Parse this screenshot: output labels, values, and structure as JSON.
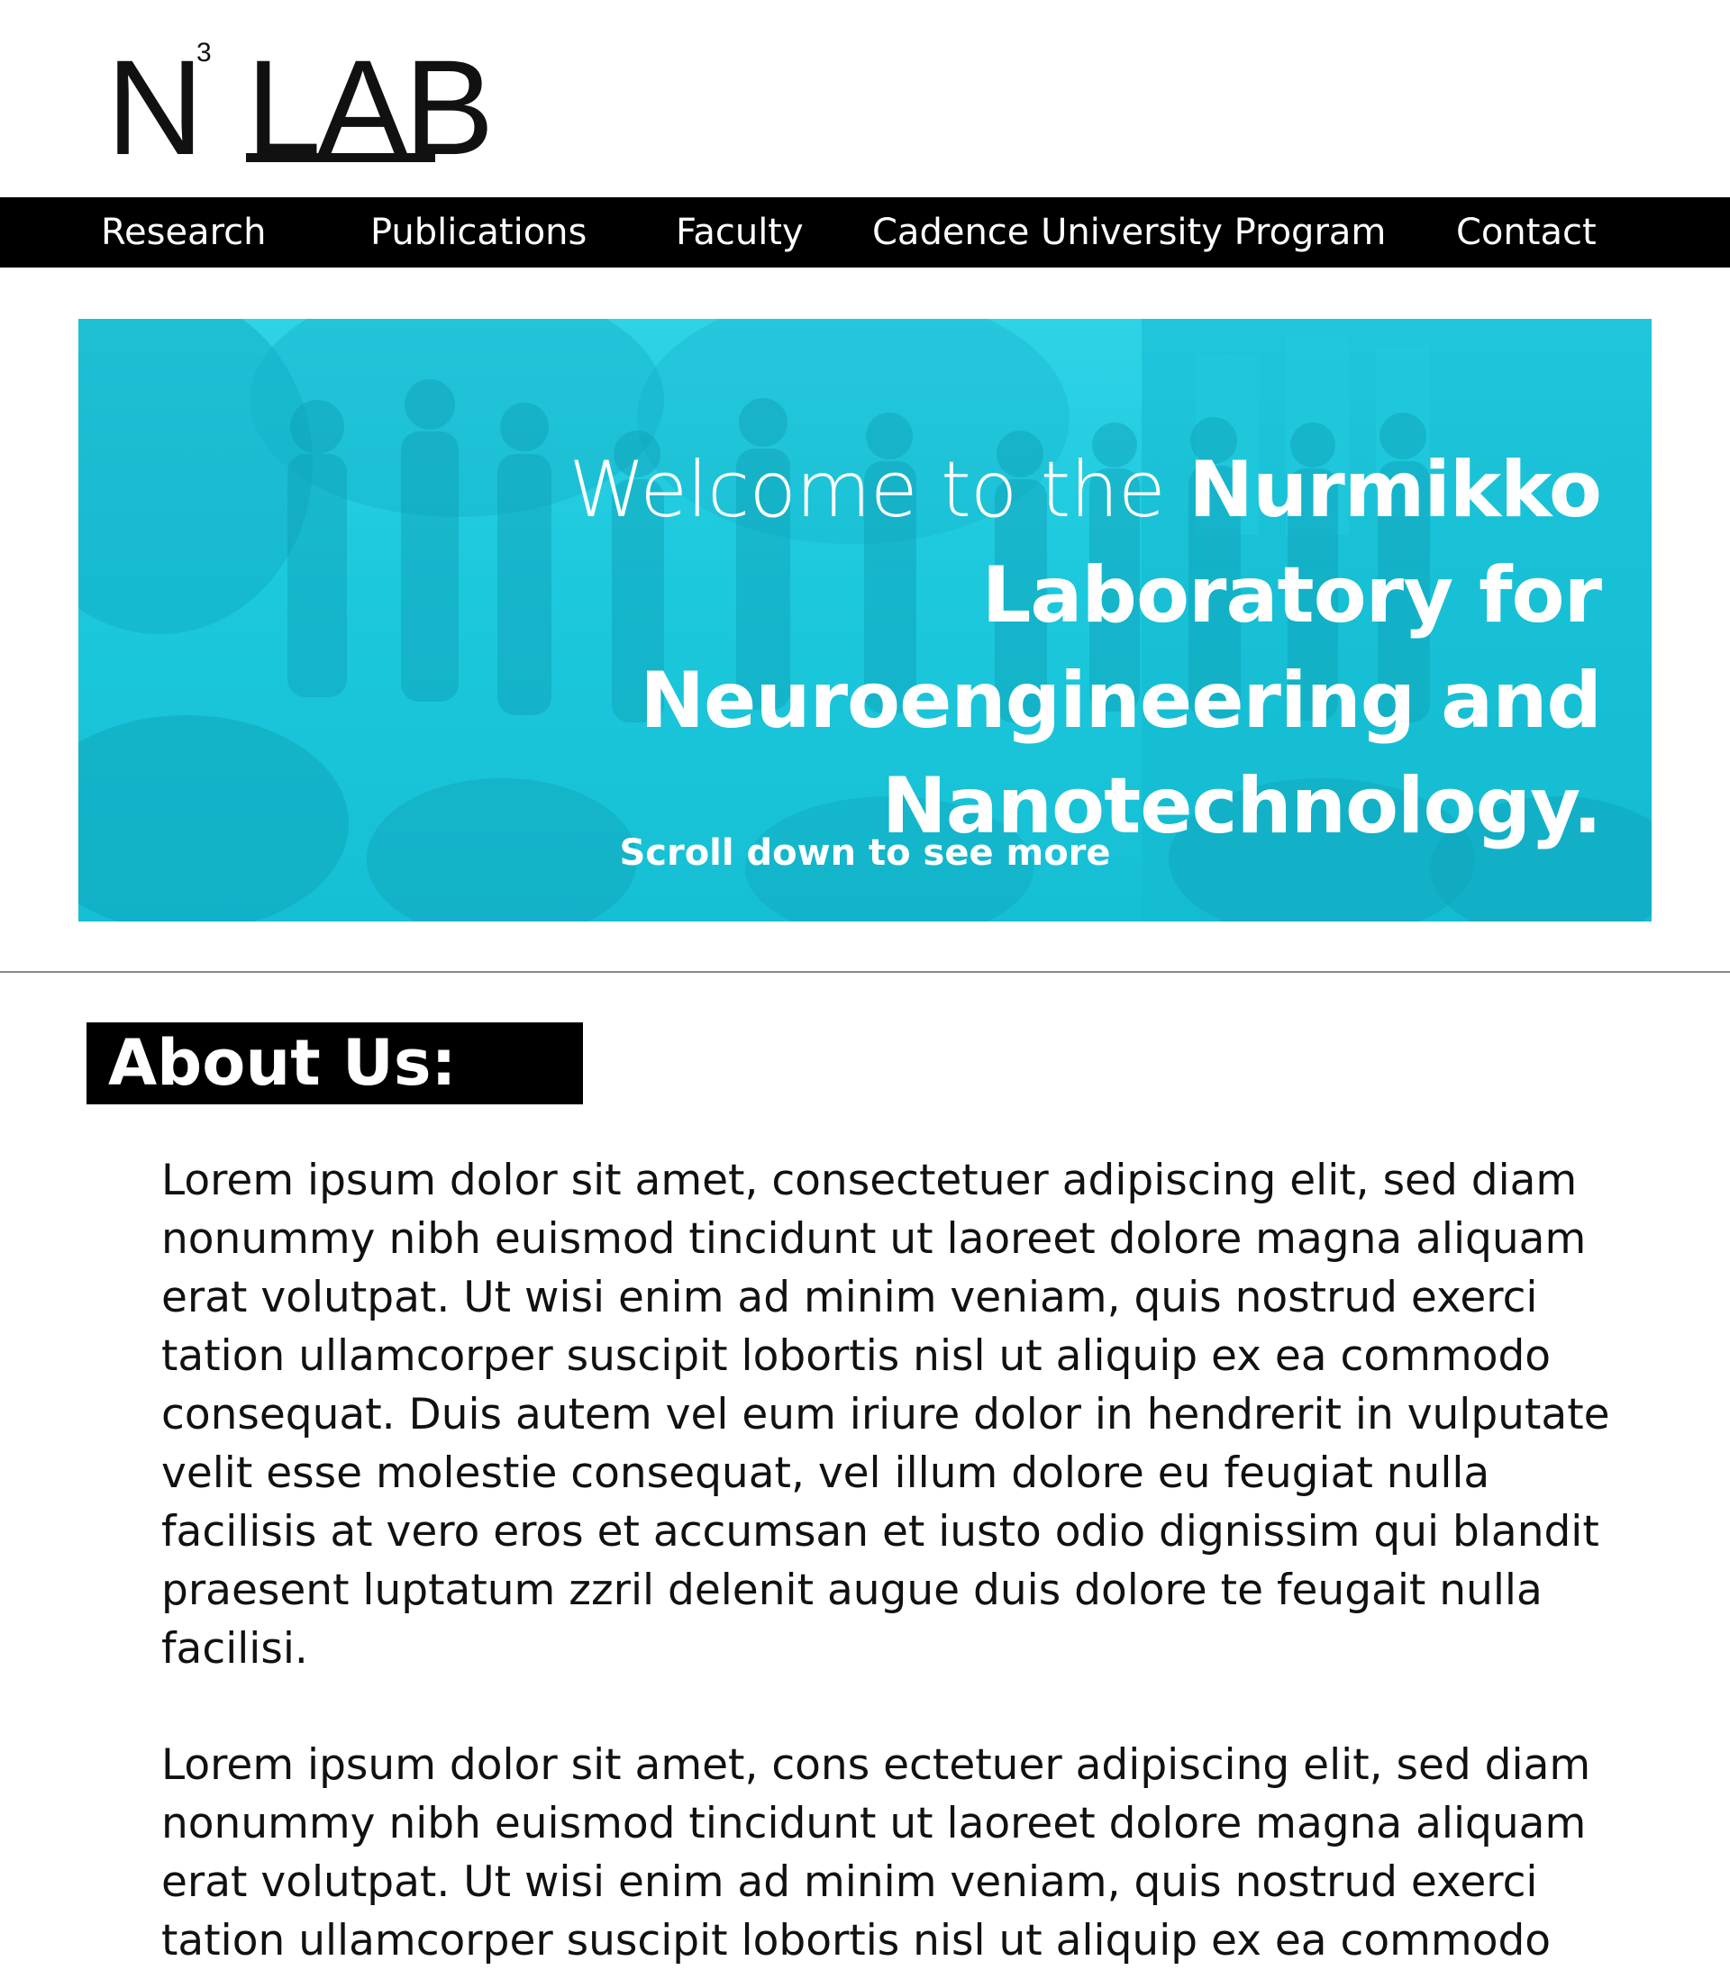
{
  "logo": {
    "letter": "N",
    "superscript": "3",
    "word": "LAB"
  },
  "nav": {
    "items": [
      {
        "label": "Research"
      },
      {
        "label": "Publications"
      },
      {
        "label": "Faculty"
      },
      {
        "label": "Cadence University Program"
      },
      {
        "label": "Contact"
      }
    ]
  },
  "hero": {
    "title_light": "Welcome to the ",
    "title_bold": "Nurmikko Laboratory for Neuroengineering and Nanotechnology.",
    "scroll_label": "Scroll down to see more",
    "overlay_color": "#1cc8dc"
  },
  "about": {
    "heading": "About Us:",
    "paragraphs": [
      "Lorem ipsum dolor sit amet, consectetuer adipiscing elit, sed diam nonummy nibh euismod tincidunt ut laoreet dolore magna aliquam erat volutpat. Ut wisi enim ad minim veniam, quis nostrud exerci tation ullamcorper suscipit lobortis nisl ut aliquip ex ea commodo consequat. Duis autem vel eum iriure dolor in hendrerit in vulputate velit esse molestie consequat, vel illum dolore eu feugiat nulla facilisis at vero eros et accumsan et iusto odio dignissim qui blandit praesent luptatum zzril delenit augue duis dolore te feugait nulla facilisi.",
      "Lorem ipsum dolor sit amet, cons ectetuer adipiscing elit, sed diam nonummy nibh euismod tincidunt ut laoreet dolore magna aliquam erat volutpat. Ut wisi enim ad minim veniam, quis nostrud exerci tation ullamcorper suscipit lobortis nisl ut aliquip ex ea commodo"
    ]
  },
  "colors": {
    "nav_bg": "#000000",
    "hero_accent": "#1cc8dc",
    "text": "#111111"
  }
}
